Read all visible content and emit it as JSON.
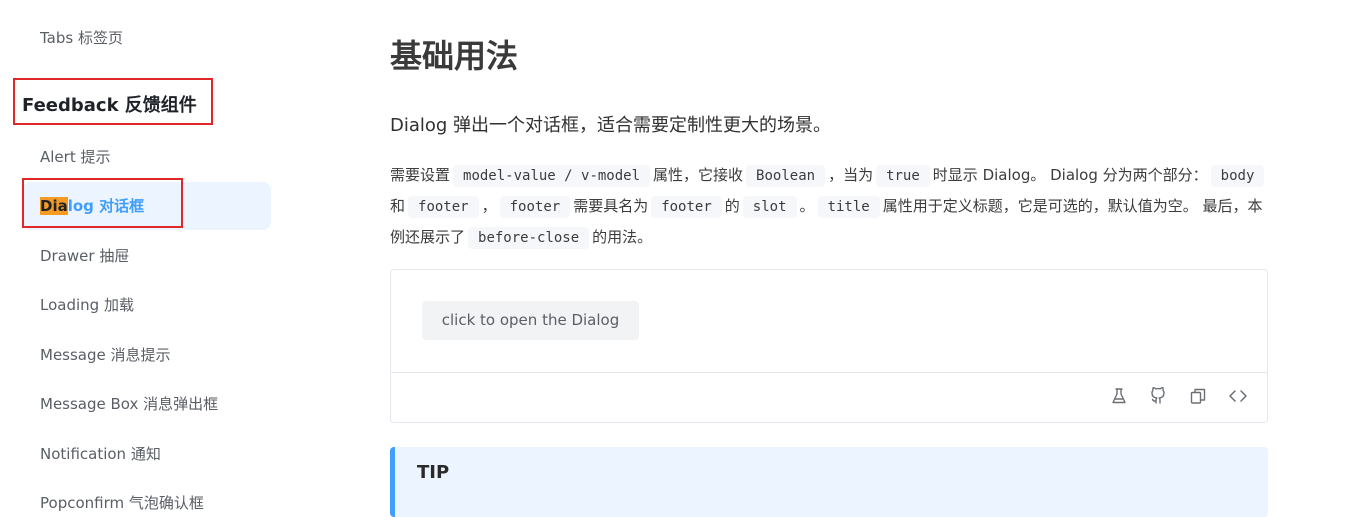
{
  "sidebar": {
    "items_top": [
      {
        "label": "Tabs 标签页"
      }
    ],
    "group_title": "Feedback 反馈组件",
    "active": {
      "highlight": "Dia",
      "rest": "log 对话框"
    },
    "items": [
      {
        "label": "Alert 提示"
      },
      {
        "label": "Drawer 抽屉"
      },
      {
        "label": "Loading 加载"
      },
      {
        "label": "Message 消息提示"
      },
      {
        "label": "Message Box 消息弹出框"
      },
      {
        "label": "Notification 通知"
      },
      {
        "label": "Popconfirm 气泡确认框"
      }
    ]
  },
  "main": {
    "title": "基础用法",
    "lead": "Dialog 弹出一个对话框，适合需要定制性更大的场景。",
    "para": {
      "t1": "需要设置",
      "c1": "model-value / v-model",
      "t2": "属性，它接收",
      "c2": "Boolean",
      "t3": "，当为",
      "c3": "true",
      "t4": "时显示 Dialog。 Dialog 分为两个部分：",
      "c4": "body",
      "t5": "和",
      "c5": "footer",
      "t6": "，",
      "c6": "footer",
      "t7": "需要具名为",
      "c7": "footer",
      "t8": "的",
      "c8": "slot",
      "t9": "。",
      "c9": "title",
      "t10": "属性用于定义标题，它是可选的，默认值为空。 最后，本例还展示了",
      "c10": "before-close",
      "t11": "的用法。"
    },
    "demo": {
      "button_label": "click to open the Dialog",
      "icons": [
        "playground-icon",
        "github-icon",
        "copy-icon",
        "code-icon"
      ]
    },
    "tip": {
      "title": "TIP"
    }
  },
  "colors": {
    "accent": "#409eff",
    "highlight": "#f59a23",
    "annotation": "#e0272a"
  }
}
